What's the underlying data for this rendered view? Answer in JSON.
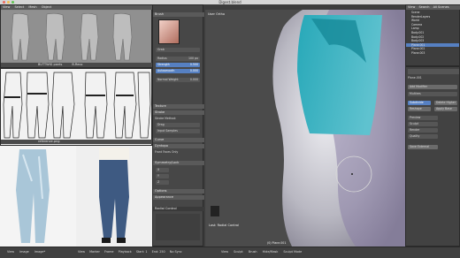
{
  "window": {
    "title": "Digest.blend"
  },
  "top_left": {
    "header_items": [
      "View",
      "Select",
      "Mesh",
      "Object"
    ],
    "image_name_a": "BUTTWIG pants",
    "image_name_b": "B.Reco"
  },
  "mid_left": {
    "image_name": "reference.png"
  },
  "tool_panel": {
    "header": "Brush",
    "brush_name": "Grab",
    "radius_label": "Radius",
    "radius_value": "100 px",
    "strength_label": "Strength",
    "strength_value": "0.500",
    "autosmooth_label": "Autosmooth",
    "autosmooth_value": "0.000",
    "normal_weight_label": "Normal Weight",
    "normal_weight_value": "0.000",
    "sections": [
      "Texture",
      "Stroke",
      "Curve",
      "Dyntopo",
      "Symmetry/Lock",
      "Options",
      "Appearance"
    ],
    "stroke_method_label": "Stroke Method:",
    "stroke_method_value": "Drag",
    "jitter_label": "Input Samples",
    "front_faces_label": "Front Faces Only",
    "symmetry_x": "X",
    "symmetry_y": "Y",
    "symmetry_z": "Z",
    "radial_label": "Radial Control"
  },
  "viewport": {
    "view_label": "User Ortho",
    "object_label": "(0) Plane.001",
    "status_label": "Last: Radial Control",
    "header_items": [
      "View",
      "Sculpt",
      "Brush",
      "Hide/Mask",
      "Sculpt Mode"
    ]
  },
  "outliner": {
    "header": "All Scenes",
    "tabs": [
      "View",
      "Search"
    ],
    "items": [
      "Scene",
      "RenderLayers",
      "World",
      "Camera",
      "Lamp",
      "Body.001",
      "Body.002",
      "Body.003",
      "Plane.001",
      "Plane.002",
      "Plane.003"
    ]
  },
  "properties": {
    "object_name": "Plane.001",
    "add_modifier": "Add Modifier",
    "modifier_name": "Multires",
    "subdivide": "Subdivide",
    "delete_higher": "Delete Higher",
    "reshape": "Reshape",
    "apply_base": "Apply Base",
    "rows": [
      "Preview",
      "Sculpt",
      "Render",
      "Quality"
    ],
    "save_external": "Save External"
  },
  "bottom": {
    "left_items": [
      "View",
      "Image",
      "Image*"
    ],
    "right_items": [
      "View",
      "Marker",
      "Frame",
      "Playback",
      "Start: 1",
      "End: 250",
      "No Sync"
    ]
  }
}
